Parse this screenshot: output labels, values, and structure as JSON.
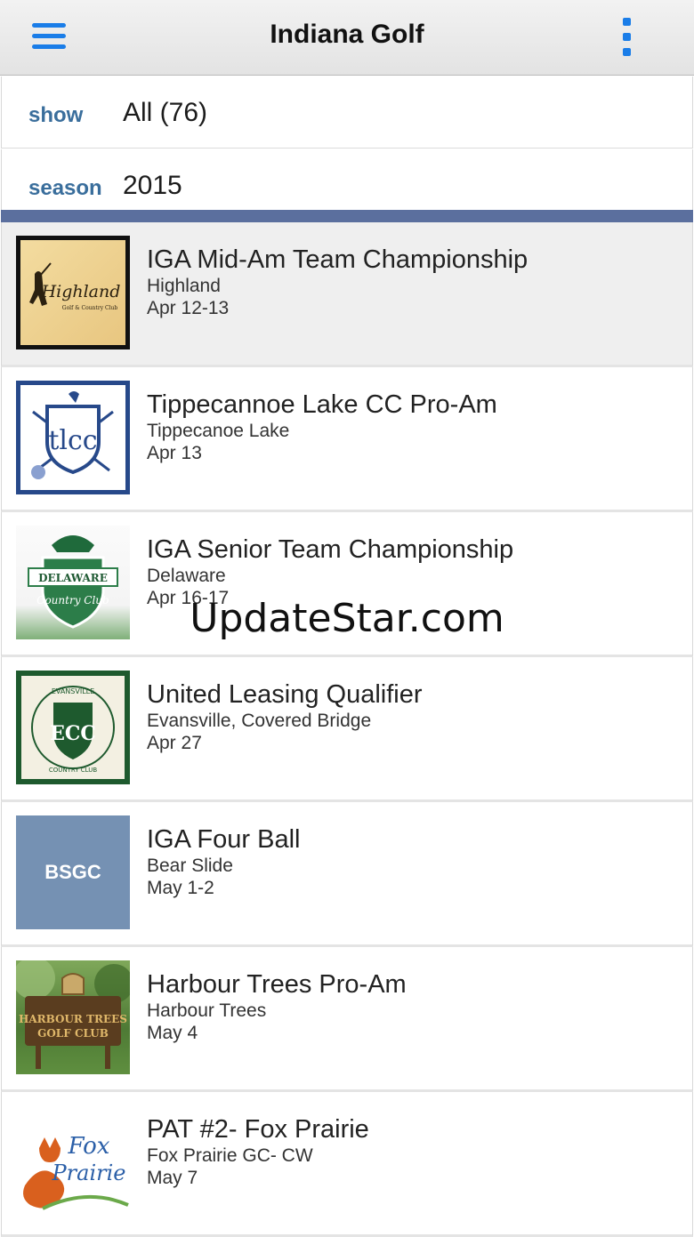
{
  "nav": {
    "title": "Indiana Golf"
  },
  "filters": {
    "show": {
      "label": "show",
      "value": "All (76)"
    },
    "season": {
      "label": "season",
      "value": "2015"
    }
  },
  "events": [
    {
      "title": "IGA Mid-Am Team Championship",
      "course": "Highland",
      "date": "Apr 12-13",
      "logo": "Highland",
      "logo_sub": "Golf & Country Club",
      "selected": true
    },
    {
      "title": "Tippecannoe Lake CC Pro-Am",
      "course": "Tippecanoe Lake",
      "date": "Apr 13",
      "logo": "tlcc"
    },
    {
      "title": "IGA Senior Team Championship",
      "course": "Delaware",
      "date": "Apr 16-17",
      "logo": "DELAWARE",
      "logo_sub": "Country Club"
    },
    {
      "title": "United Leasing Qualifier",
      "course": "Evansville, Covered Bridge",
      "date": "Apr 27",
      "logo": "ECC",
      "logo_top": "EVANSVILLE",
      "logo_sub": "COUNTRY CLUB"
    },
    {
      "title": "IGA Four Ball",
      "course": "Bear Slide",
      "date": "May 1-2",
      "logo": "BSGC"
    },
    {
      "title": "Harbour Trees Pro-Am",
      "course": "Harbour Trees",
      "date": "May 4",
      "logo": "HARBOUR TREES",
      "logo_sub": "GOLF CLUB"
    },
    {
      "title": "PAT #2- Fox Prairie",
      "course": "Fox Prairie GC- CW",
      "date": "May 7",
      "logo": "Fox",
      "logo_sub": "Prairie"
    }
  ],
  "watermark": "UpdateStar.com",
  "colors": {
    "accent": "#1a7de8",
    "label": "#3a6e9c",
    "section_bar": "#5b6f9e"
  }
}
